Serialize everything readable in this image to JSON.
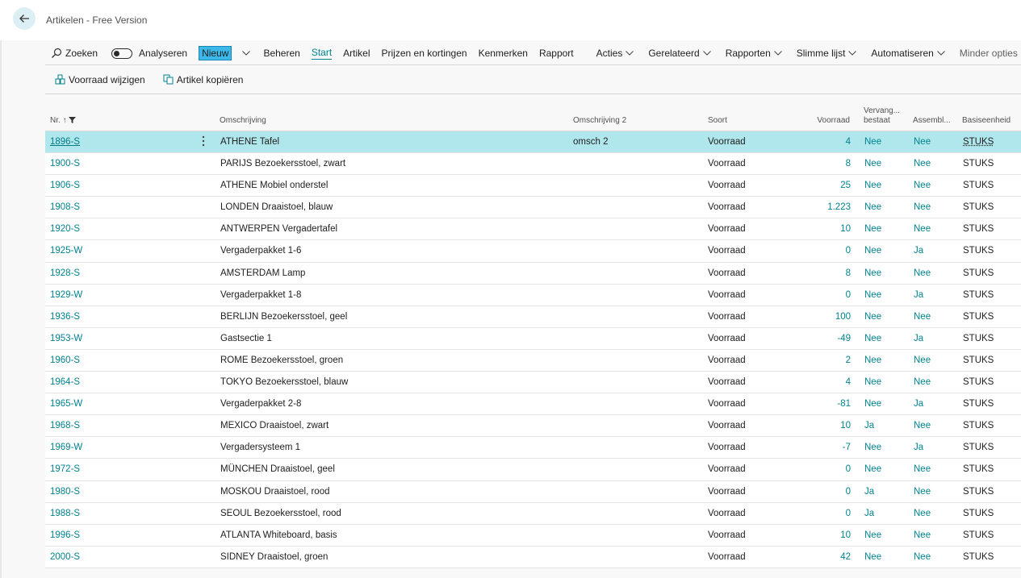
{
  "header": {
    "title": "Artikelen - Free Version"
  },
  "actionbar": {
    "search": "Zoeken",
    "analyze": "Analyseren",
    "new": "Nieuw",
    "manage": "Beheren",
    "start": "Start",
    "item": "Artikel",
    "prices": "Prijzen en kortingen",
    "attributes": "Kenmerken",
    "report": "Rapport",
    "actions": "Acties",
    "related": "Gerelateerd",
    "reports": "Rapporten",
    "smartlist": "Slimme lijst",
    "automate": "Automatiseren",
    "fewer": "Minder opties"
  },
  "subbar": {
    "adjust_inventory": "Voorraad wijzigen",
    "copy_item": "Artikel kopiëren"
  },
  "columns": {
    "nr": "Nr.",
    "sort_arrow": "↑",
    "description": "Omschrijving",
    "description2": "Omschrijving 2",
    "type": "Soort",
    "inventory": "Voorraad",
    "substitutes_1": "Vervang...",
    "substitutes_2": "bestaat",
    "assembly": "Assembl...",
    "base_unit": "Basiseenheid"
  },
  "rows": [
    {
      "nr": "1896-S",
      "desc": "ATHENE Tafel",
      "desc2": "omsch 2",
      "type": "Voorraad",
      "inv": "4",
      "subst": "Nee",
      "asm": "Nee",
      "unit": "STUKS"
    },
    {
      "nr": "1900-S",
      "desc": "PARIJS Bezoekersstoel, zwart",
      "desc2": "",
      "type": "Voorraad",
      "inv": "8",
      "subst": "Nee",
      "asm": "Nee",
      "unit": "STUKS"
    },
    {
      "nr": "1906-S",
      "desc": "ATHENE Mobiel onderstel",
      "desc2": "",
      "type": "Voorraad",
      "inv": "25",
      "subst": "Nee",
      "asm": "Nee",
      "unit": "STUKS"
    },
    {
      "nr": "1908-S",
      "desc": "LONDEN Draaistoel, blauw",
      "desc2": "",
      "type": "Voorraad",
      "inv": "1.223",
      "subst": "Nee",
      "asm": "Nee",
      "unit": "STUKS"
    },
    {
      "nr": "1920-S",
      "desc": "ANTWERPEN Vergadertafel",
      "desc2": "",
      "type": "Voorraad",
      "inv": "10",
      "subst": "Nee",
      "asm": "Nee",
      "unit": "STUKS"
    },
    {
      "nr": "1925-W",
      "desc": "Vergaderpakket 1-6",
      "desc2": "",
      "type": "Voorraad",
      "inv": "0",
      "subst": "Nee",
      "asm": "Ja",
      "unit": "STUKS"
    },
    {
      "nr": "1928-S",
      "desc": "AMSTERDAM Lamp",
      "desc2": "",
      "type": "Voorraad",
      "inv": "8",
      "subst": "Nee",
      "asm": "Nee",
      "unit": "STUKS"
    },
    {
      "nr": "1929-W",
      "desc": "Vergaderpakket 1-8",
      "desc2": "",
      "type": "Voorraad",
      "inv": "0",
      "subst": "Nee",
      "asm": "Ja",
      "unit": "STUKS"
    },
    {
      "nr": "1936-S",
      "desc": "BERLIJN Bezoekersstoel, geel",
      "desc2": "",
      "type": "Voorraad",
      "inv": "100",
      "subst": "Nee",
      "asm": "Nee",
      "unit": "STUKS"
    },
    {
      "nr": "1953-W",
      "desc": "Gastsectie 1",
      "desc2": "",
      "type": "Voorraad",
      "inv": "-49",
      "subst": "Nee",
      "asm": "Ja",
      "unit": "STUKS"
    },
    {
      "nr": "1960-S",
      "desc": "ROME Bezoekersstoel, groen",
      "desc2": "",
      "type": "Voorraad",
      "inv": "2",
      "subst": "Nee",
      "asm": "Nee",
      "unit": "STUKS"
    },
    {
      "nr": "1964-S",
      "desc": "TOKYO Bezoekersstoel, blauw",
      "desc2": "",
      "type": "Voorraad",
      "inv": "4",
      "subst": "Nee",
      "asm": "Nee",
      "unit": "STUKS"
    },
    {
      "nr": "1965-W",
      "desc": "Vergaderpakket 2-8",
      "desc2": "",
      "type": "Voorraad",
      "inv": "-81",
      "subst": "Nee",
      "asm": "Ja",
      "unit": "STUKS"
    },
    {
      "nr": "1968-S",
      "desc": "MEXICO Draaistoel, zwart",
      "desc2": "",
      "type": "Voorraad",
      "inv": "10",
      "subst": "Ja",
      "asm": "Nee",
      "unit": "STUKS"
    },
    {
      "nr": "1969-W",
      "desc": "Vergadersysteem 1",
      "desc2": "",
      "type": "Voorraad",
      "inv": "-7",
      "subst": "Nee",
      "asm": "Ja",
      "unit": "STUKS"
    },
    {
      "nr": "1972-S",
      "desc": "MÜNCHEN Draaistoel, geel",
      "desc2": "",
      "type": "Voorraad",
      "inv": "0",
      "subst": "Nee",
      "asm": "Nee",
      "unit": "STUKS"
    },
    {
      "nr": "1980-S",
      "desc": "MOSKOU Draaistoel, rood",
      "desc2": "",
      "type": "Voorraad",
      "inv": "0",
      "subst": "Ja",
      "asm": "Nee",
      "unit": "STUKS"
    },
    {
      "nr": "1988-S",
      "desc": "SEOUL Bezoekersstoel, rood",
      "desc2": "",
      "type": "Voorraad",
      "inv": "0",
      "subst": "Ja",
      "asm": "Nee",
      "unit": "STUKS"
    },
    {
      "nr": "1996-S",
      "desc": "ATLANTA Whiteboard, basis",
      "desc2": "",
      "type": "Voorraad",
      "inv": "10",
      "subst": "Nee",
      "asm": "Nee",
      "unit": "STUKS"
    },
    {
      "nr": "2000-S",
      "desc": "SIDNEY Draaistoel, groen",
      "desc2": "",
      "type": "Voorraad",
      "inv": "42",
      "subst": "Nee",
      "asm": "Nee",
      "unit": "STUKS"
    }
  ],
  "selected_row": 0,
  "colors": {
    "accent": "#00838f",
    "selected_row": "#b0e7ec",
    "new_highlight": "#3bb7e8"
  }
}
